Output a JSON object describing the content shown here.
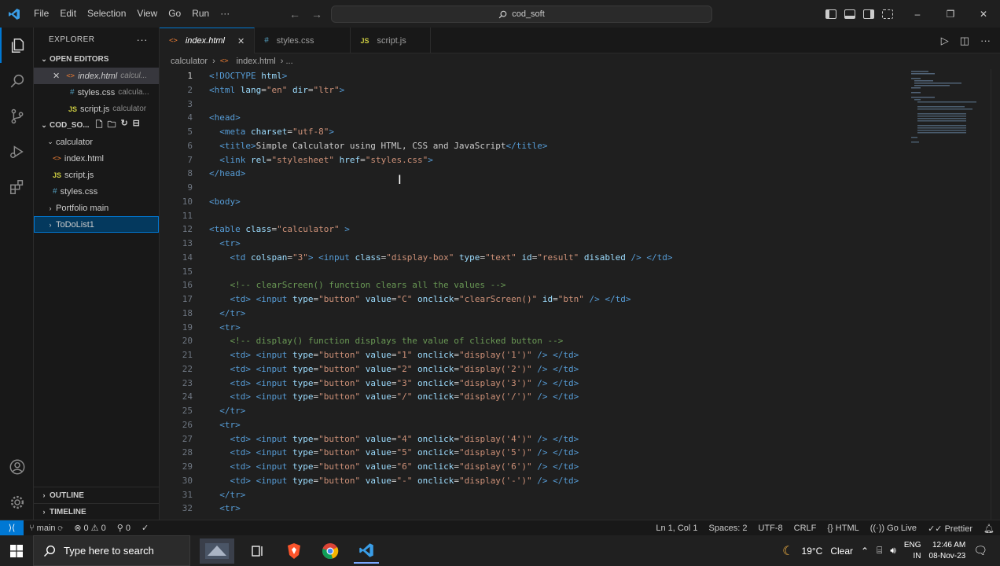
{
  "titlebar": {
    "menu": [
      "File",
      "Edit",
      "Selection",
      "View",
      "Go",
      "Run",
      "···"
    ],
    "search_text": "cod_soft",
    "controls": {
      "minimize": "–",
      "restore": "❐",
      "close": "✕"
    }
  },
  "sidebar": {
    "title": "EXPLORER",
    "more": "···",
    "open_editors_label": "OPEN EDITORS",
    "open_editors": [
      {
        "name": "index.html",
        "folder": "calcul...",
        "type": "html",
        "active": true
      },
      {
        "name": "styles.css",
        "folder": "calcula...",
        "type": "css"
      },
      {
        "name": "script.js",
        "folder": "calculator",
        "type": "js"
      }
    ],
    "workspace_label": "COD_SO...",
    "tree": [
      {
        "name": "calculator",
        "kind": "folder-open",
        "depth": 1
      },
      {
        "name": "index.html",
        "kind": "html",
        "depth": 2
      },
      {
        "name": "script.js",
        "kind": "js",
        "depth": 2
      },
      {
        "name": "styles.css",
        "kind": "css",
        "depth": 2
      },
      {
        "name": "Portfolio main",
        "kind": "folder",
        "depth": 1
      },
      {
        "name": "ToDoList1",
        "kind": "folder",
        "depth": 1,
        "selected": true
      }
    ],
    "outline_label": "OUTLINE",
    "timeline_label": "TIMELINE"
  },
  "tabs": [
    {
      "name": "index.html",
      "type": "html",
      "active": true,
      "close": "✕"
    },
    {
      "name": "styles.css",
      "type": "css"
    },
    {
      "name": "script.js",
      "type": "js"
    }
  ],
  "breadcrumbs": {
    "folder": "calculator",
    "separator": "›",
    "file": "index.html",
    "tail": "› ..."
  },
  "editor": {
    "current_line": 1,
    "lines": [
      [
        [
          "tag",
          "<!DOCTYPE "
        ],
        [
          "attr",
          "html"
        ],
        [
          "tag",
          ">"
        ]
      ],
      [
        [
          "tag",
          "<html "
        ],
        [
          "attr",
          "lang"
        ],
        [
          "txt",
          "="
        ],
        [
          "str",
          "\"en\""
        ],
        [
          "txt",
          " "
        ],
        [
          "attr",
          "dir"
        ],
        [
          "txt",
          "="
        ],
        [
          "str",
          "\"ltr\""
        ],
        [
          "tag",
          ">"
        ]
      ],
      [],
      [
        [
          "tag",
          "<head>"
        ]
      ],
      [
        [
          "txt",
          "  "
        ],
        [
          "tag",
          "<meta "
        ],
        [
          "attr",
          "charset"
        ],
        [
          "txt",
          "="
        ],
        [
          "str",
          "\"utf-8\""
        ],
        [
          "tag",
          ">"
        ]
      ],
      [
        [
          "txt",
          "  "
        ],
        [
          "tag",
          "<title>"
        ],
        [
          "txt",
          "Simple Calculator using HTML, CSS and JavaScript"
        ],
        [
          "tag",
          "</title>"
        ]
      ],
      [
        [
          "txt",
          "  "
        ],
        [
          "tag",
          "<link "
        ],
        [
          "attr",
          "rel"
        ],
        [
          "txt",
          "="
        ],
        [
          "str",
          "\"stylesheet\""
        ],
        [
          "txt",
          " "
        ],
        [
          "attr",
          "href"
        ],
        [
          "txt",
          "="
        ],
        [
          "str",
          "\"styles.css\""
        ],
        [
          "tag",
          ">"
        ]
      ],
      [
        [
          "tag",
          "</head>"
        ]
      ],
      [],
      [
        [
          "tag",
          "<body>"
        ]
      ],
      [],
      [
        [
          "tag",
          "<table "
        ],
        [
          "attr",
          "class"
        ],
        [
          "txt",
          "="
        ],
        [
          "str",
          "\"calculator\""
        ],
        [
          "txt",
          " "
        ],
        [
          "tag",
          ">"
        ]
      ],
      [
        [
          "txt",
          "  "
        ],
        [
          "tag",
          "<tr>"
        ]
      ],
      [
        [
          "txt",
          "    "
        ],
        [
          "tag",
          "<td "
        ],
        [
          "attr",
          "colspan"
        ],
        [
          "txt",
          "="
        ],
        [
          "str",
          "\"3\""
        ],
        [
          "tag",
          "> <input "
        ],
        [
          "attr",
          "class"
        ],
        [
          "txt",
          "="
        ],
        [
          "str",
          "\"display-box\""
        ],
        [
          "txt",
          " "
        ],
        [
          "attr",
          "type"
        ],
        [
          "txt",
          "="
        ],
        [
          "str",
          "\"text\""
        ],
        [
          "txt",
          " "
        ],
        [
          "attr",
          "id"
        ],
        [
          "txt",
          "="
        ],
        [
          "str",
          "\"result\""
        ],
        [
          "txt",
          " "
        ],
        [
          "attr",
          "disabled"
        ],
        [
          "tag",
          " /> </td>"
        ]
      ],
      [],
      [
        [
          "txt",
          "    "
        ],
        [
          "com",
          "<!-- clearScreen() function clears all the values -->"
        ]
      ],
      [
        [
          "txt",
          "    "
        ],
        [
          "tag",
          "<td> <input "
        ],
        [
          "attr",
          "type"
        ],
        [
          "txt",
          "="
        ],
        [
          "str",
          "\"button\""
        ],
        [
          "txt",
          " "
        ],
        [
          "attr",
          "value"
        ],
        [
          "txt",
          "="
        ],
        [
          "str",
          "\"C\""
        ],
        [
          "txt",
          " "
        ],
        [
          "attr",
          "onclick"
        ],
        [
          "txt",
          "="
        ],
        [
          "str",
          "\"clearScreen()\""
        ],
        [
          "txt",
          " "
        ],
        [
          "attr",
          "id"
        ],
        [
          "txt",
          "="
        ],
        [
          "str",
          "\"btn\""
        ],
        [
          "tag",
          " /> </td>"
        ]
      ],
      [
        [
          "txt",
          "  "
        ],
        [
          "tag",
          "</tr>"
        ]
      ],
      [
        [
          "txt",
          "  "
        ],
        [
          "tag",
          "<tr>"
        ]
      ],
      [
        [
          "txt",
          "    "
        ],
        [
          "com",
          "<!-- display() function displays the value of clicked button -->"
        ]
      ],
      [
        [
          "txt",
          "    "
        ],
        [
          "tag",
          "<td> <input "
        ],
        [
          "attr",
          "type"
        ],
        [
          "txt",
          "="
        ],
        [
          "str",
          "\"button\""
        ],
        [
          "txt",
          " "
        ],
        [
          "attr",
          "value"
        ],
        [
          "txt",
          "="
        ],
        [
          "str",
          "\"1\""
        ],
        [
          "txt",
          " "
        ],
        [
          "attr",
          "onclick"
        ],
        [
          "txt",
          "="
        ],
        [
          "str",
          "\"display('1')\""
        ],
        [
          "tag",
          " /> </td>"
        ]
      ],
      [
        [
          "txt",
          "    "
        ],
        [
          "tag",
          "<td> <input "
        ],
        [
          "attr",
          "type"
        ],
        [
          "txt",
          "="
        ],
        [
          "str",
          "\"button\""
        ],
        [
          "txt",
          " "
        ],
        [
          "attr",
          "value"
        ],
        [
          "txt",
          "="
        ],
        [
          "str",
          "\"2\""
        ],
        [
          "txt",
          " "
        ],
        [
          "attr",
          "onclick"
        ],
        [
          "txt",
          "="
        ],
        [
          "str",
          "\"display('2')\""
        ],
        [
          "tag",
          " /> </td>"
        ]
      ],
      [
        [
          "txt",
          "    "
        ],
        [
          "tag",
          "<td> <input "
        ],
        [
          "attr",
          "type"
        ],
        [
          "txt",
          "="
        ],
        [
          "str",
          "\"button\""
        ],
        [
          "txt",
          " "
        ],
        [
          "attr",
          "value"
        ],
        [
          "txt",
          "="
        ],
        [
          "str",
          "\"3\""
        ],
        [
          "txt",
          " "
        ],
        [
          "attr",
          "onclick"
        ],
        [
          "txt",
          "="
        ],
        [
          "str",
          "\"display('3')\""
        ],
        [
          "tag",
          " /> </td>"
        ]
      ],
      [
        [
          "txt",
          "    "
        ],
        [
          "tag",
          "<td> <input "
        ],
        [
          "attr",
          "type"
        ],
        [
          "txt",
          "="
        ],
        [
          "str",
          "\"button\""
        ],
        [
          "txt",
          " "
        ],
        [
          "attr",
          "value"
        ],
        [
          "txt",
          "="
        ],
        [
          "str",
          "\"/\""
        ],
        [
          "txt",
          " "
        ],
        [
          "attr",
          "onclick"
        ],
        [
          "txt",
          "="
        ],
        [
          "str",
          "\"display('/')\""
        ],
        [
          "tag",
          " /> </td>"
        ]
      ],
      [
        [
          "txt",
          "  "
        ],
        [
          "tag",
          "</tr>"
        ]
      ],
      [
        [
          "txt",
          "  "
        ],
        [
          "tag",
          "<tr>"
        ]
      ],
      [
        [
          "txt",
          "    "
        ],
        [
          "tag",
          "<td> <input "
        ],
        [
          "attr",
          "type"
        ],
        [
          "txt",
          "="
        ],
        [
          "str",
          "\"button\""
        ],
        [
          "txt",
          " "
        ],
        [
          "attr",
          "value"
        ],
        [
          "txt",
          "="
        ],
        [
          "str",
          "\"4\""
        ],
        [
          "txt",
          " "
        ],
        [
          "attr",
          "onclick"
        ],
        [
          "txt",
          "="
        ],
        [
          "str",
          "\"display('4')\""
        ],
        [
          "tag",
          " /> </td>"
        ]
      ],
      [
        [
          "txt",
          "    "
        ],
        [
          "tag",
          "<td> <input "
        ],
        [
          "attr",
          "type"
        ],
        [
          "txt",
          "="
        ],
        [
          "str",
          "\"button\""
        ],
        [
          "txt",
          " "
        ],
        [
          "attr",
          "value"
        ],
        [
          "txt",
          "="
        ],
        [
          "str",
          "\"5\""
        ],
        [
          "txt",
          " "
        ],
        [
          "attr",
          "onclick"
        ],
        [
          "txt",
          "="
        ],
        [
          "str",
          "\"display('5')\""
        ],
        [
          "tag",
          " /> </td>"
        ]
      ],
      [
        [
          "txt",
          "    "
        ],
        [
          "tag",
          "<td> <input "
        ],
        [
          "attr",
          "type"
        ],
        [
          "txt",
          "="
        ],
        [
          "str",
          "\"button\""
        ],
        [
          "txt",
          " "
        ],
        [
          "attr",
          "value"
        ],
        [
          "txt",
          "="
        ],
        [
          "str",
          "\"6\""
        ],
        [
          "txt",
          " "
        ],
        [
          "attr",
          "onclick"
        ],
        [
          "txt",
          "="
        ],
        [
          "str",
          "\"display('6')\""
        ],
        [
          "tag",
          " /> </td>"
        ]
      ],
      [
        [
          "txt",
          "    "
        ],
        [
          "tag",
          "<td> <input "
        ],
        [
          "attr",
          "type"
        ],
        [
          "txt",
          "="
        ],
        [
          "str",
          "\"button\""
        ],
        [
          "txt",
          " "
        ],
        [
          "attr",
          "value"
        ],
        [
          "txt",
          "="
        ],
        [
          "str",
          "\"-\""
        ],
        [
          "txt",
          " "
        ],
        [
          "attr",
          "onclick"
        ],
        [
          "txt",
          "="
        ],
        [
          "str",
          "\"display('-')\""
        ],
        [
          "tag",
          " /> </td>"
        ]
      ],
      [
        [
          "txt",
          "  "
        ],
        [
          "tag",
          "</tr>"
        ]
      ],
      [
        [
          "txt",
          "  "
        ],
        [
          "tag",
          "<tr>"
        ]
      ]
    ]
  },
  "statusbar": {
    "branch": "main",
    "errors": "0",
    "warnings": "0",
    "ports": "0",
    "position": "Ln 1, Col 1",
    "spaces": "Spaces: 2",
    "encoding": "UTF-8",
    "eol": "CRLF",
    "language": "HTML",
    "golive": "Go Live",
    "prettier": "Prettier"
  },
  "taskbar": {
    "search_placeholder": "Type here to search",
    "weather": "19°C",
    "weather_desc": "Clear",
    "lang": "ENG",
    "region": "IN",
    "time": "12:46 AM",
    "date": "08-Nov-23"
  },
  "colors": {
    "accent": "#0078d4",
    "tag": "#569cd6",
    "attr": "#9cdcfe",
    "string": "#ce9178",
    "comment": "#6a9955"
  }
}
